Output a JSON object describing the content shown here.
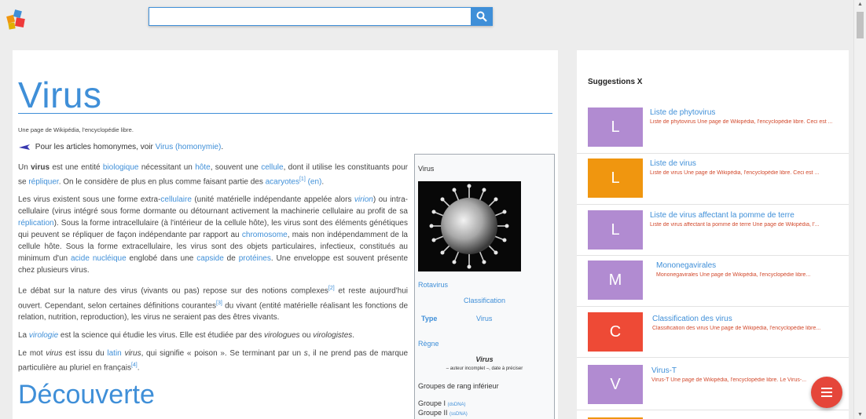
{
  "colors": {
    "accent": "#3f8fd8",
    "fab": "#e5463a",
    "snippet": "#d24a2d"
  },
  "search": {
    "value": "",
    "placeholder": ""
  },
  "article": {
    "title": "Virus",
    "from": "Une page de Wikipédia, l'encyclopédie libre.",
    "homonymie": {
      "prefix": "Pour les articles homonymes, voir ",
      "link": "Virus (homonymie)",
      "suffix": "."
    },
    "section_heading": "Découverte"
  },
  "infobox": {
    "title": "Virus",
    "image_alt": "Rotavirus",
    "caption": "Rotavirus",
    "classification_label": "Classification",
    "type_label": "Type",
    "type_value": "Virus",
    "regne": "Règne",
    "virus_italic": "Virus",
    "auteur": "– auteur incomplet –, date à préciser",
    "groupes_label": "Groupes de rang inférieur",
    "groups": [
      {
        "label": "Groupe I",
        "sub": "(dsDNA)"
      },
      {
        "label": "Groupe II",
        "sub": "(ssDNA)"
      }
    ]
  },
  "panel": {
    "title": "Suggestions X",
    "items": [
      {
        "letter": "L",
        "color": "#b18bd1",
        "title": "Liste de phytovirus",
        "snippet": "Liste de phytovirus Une page de Wikipédia, l'encyclopédie libre. Ceci est ..."
      },
      {
        "letter": "L",
        "color": "#f0960f",
        "title": "Liste de virus",
        "snippet": "Liste de virus Une page de Wikipédia, l'encyclopédie libre. Ceci est ..."
      },
      {
        "letter": "L",
        "color": "#b18bd1",
        "title": "Liste de virus affectant la pomme de terre",
        "snippet": "Liste de virus affectant la pomme de terre Une page de Wikipédia, l'..."
      },
      {
        "letter": "M",
        "color": "#b18bd1",
        "title": "Mononegavirales",
        "snippet": "Mononegavirales Une page de Wikipédia, l'encyclopédie libre..."
      },
      {
        "letter": "C",
        "color": "#ee4a36",
        "title": "Classification des virus",
        "snippet": "Classification des virus Une page de Wikipédia, l'encyclopédie libre..."
      },
      {
        "letter": "V",
        "color": "#b18bd1",
        "title": "Virus-T",
        "snippet": "Virus-T Une page de Wikipédia, l'encyclopédie libre. Le Virus-..."
      }
    ]
  }
}
